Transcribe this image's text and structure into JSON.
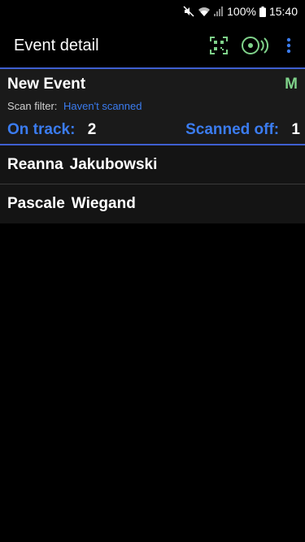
{
  "status_bar": {
    "battery_percent": "100%",
    "time": "15:40"
  },
  "app_bar": {
    "title": "Event detail",
    "icons": [
      "qr-scan-icon",
      "nfc-scan-icon",
      "more-vert-icon"
    ]
  },
  "event": {
    "name": "New Event",
    "badge": "M",
    "filter_label": "Scan filter:",
    "filter_value": "Haven't scanned",
    "on_track_label": "On track:",
    "on_track_value": "2",
    "scanned_off_label": "Scanned off:",
    "scanned_off_value": "1"
  },
  "people": [
    {
      "first": "Reanna",
      "last": "Jakubowski"
    },
    {
      "first": "Pascale",
      "last": "Wiegand"
    }
  ],
  "colors": {
    "accent_blue": "#3b7cf0",
    "accent_green": "#7fd28a",
    "header_bg": "#1a1a1a",
    "divider": "#3f5fd0"
  }
}
